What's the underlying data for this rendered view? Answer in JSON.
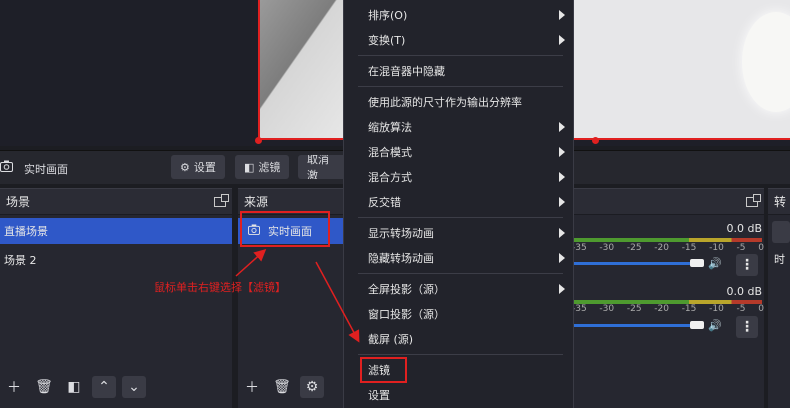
{
  "source_toolbar": {
    "source_name": "实时画面",
    "settings_label": "设置",
    "filters_label": "滤镜",
    "deactivate_label": "取消激"
  },
  "scenes": {
    "title": "场景",
    "items": [
      "直播场景",
      "场景 2"
    ]
  },
  "sources": {
    "title": "来源",
    "items": [
      "实时画面"
    ]
  },
  "mixer": {
    "channels": [
      {
        "db": "0.0 dB",
        "ticks": [
          "-35",
          "-30",
          "-25",
          "-20",
          "-15",
          "-10",
          "-5",
          "0"
        ]
      },
      {
        "db": "0.0 dB",
        "ticks": [
          "-35",
          "-30",
          "-25",
          "-20",
          "-15",
          "-10",
          "-5",
          "0"
        ]
      }
    ]
  },
  "transitions": {
    "title_fragment": "转",
    "item_fragment": "时"
  },
  "context_menu": {
    "items": [
      {
        "label": "排序(O)"
      },
      {
        "label": "变换(T)"
      },
      {
        "label": "在混音器中隐藏"
      },
      {
        "label": "使用此源的尺寸作为输出分辨率"
      },
      {
        "label": "缩放算法"
      },
      {
        "label": "混合模式"
      },
      {
        "label": "混合方式"
      },
      {
        "label": "反交错"
      },
      {
        "label": "显示转场动画"
      },
      {
        "label": "隐藏转场动画"
      },
      {
        "label": "全屏投影（源）"
      },
      {
        "label": "窗口投影（源）"
      },
      {
        "label": "截屏 (源)"
      },
      {
        "label": "滤镜"
      },
      {
        "label": "设置"
      }
    ]
  },
  "annotation": {
    "text": "鼠标单击右键选择【滤镜】"
  },
  "colors": {
    "accent": "#2f58c8",
    "annotation": "#e02020",
    "menu_bg": "#22232b"
  }
}
